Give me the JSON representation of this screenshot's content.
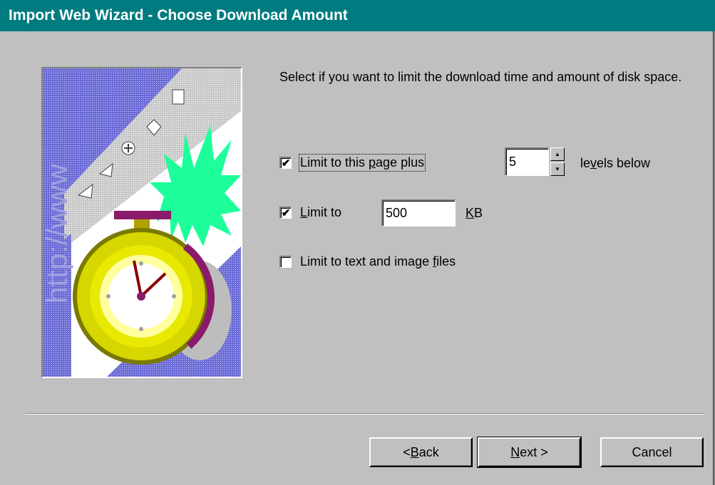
{
  "window": {
    "title": "Import Web Wizard - Choose Download Amount"
  },
  "description": "Select if you want to limit the download time and amount of disk space.",
  "options": {
    "limit_page": {
      "label_pre": "Limit to this ",
      "label_u": "p",
      "label_post": "age plus",
      "checked": true,
      "mark": "✔"
    },
    "levels": {
      "value": "5",
      "label_pre": "le",
      "label_u": "v",
      "label_post": "els below"
    },
    "limit_size": {
      "label_pre": "",
      "label_u": "L",
      "label_post": "imit to",
      "checked": true,
      "mark": "✔",
      "value": "500",
      "unit_u": "K",
      "unit_post": "B"
    },
    "limit_files": {
      "label_pre": "Limit to text and image ",
      "label_u": "f",
      "label_post": "iles",
      "checked": false,
      "mark": ""
    }
  },
  "buttons": {
    "back": {
      "pre": "< ",
      "u": "B",
      "post": "ack"
    },
    "next": {
      "pre": "",
      "u": "N",
      "post": "ext >"
    },
    "cancel": {
      "label": "Cancel"
    }
  },
  "colors": {
    "titlebar": "#007b7f",
    "face": "#c0c0c0"
  },
  "icons": [
    "stopwatch-illustration",
    "spin-up-icon",
    "spin-down-icon",
    "checkmark-icon"
  ]
}
